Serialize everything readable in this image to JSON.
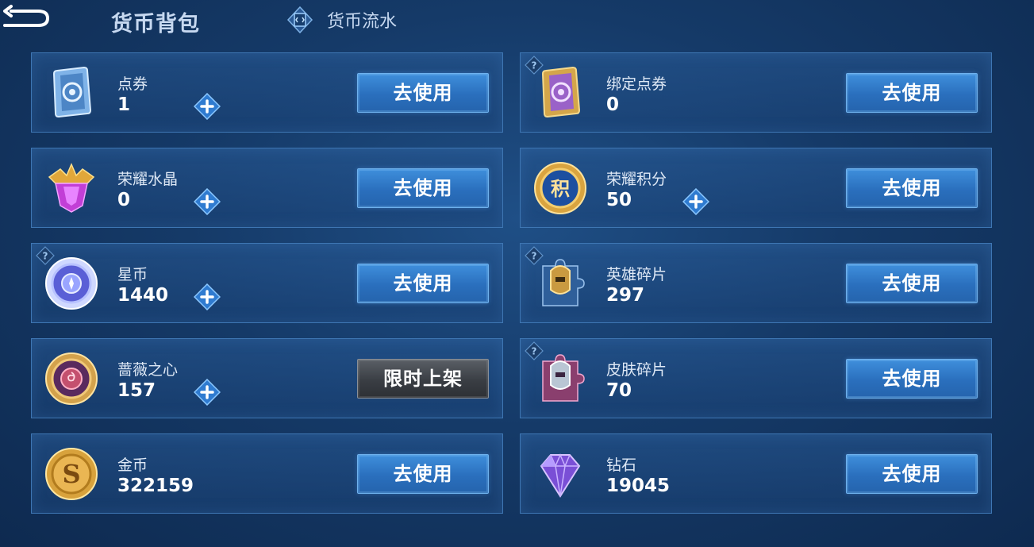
{
  "header": {
    "title": "货币背包",
    "flow_tab_label": "货币流水"
  },
  "cards": [
    {
      "name": "点券",
      "amount": "1",
      "button": "去使用",
      "has_plus": true,
      "has_help": false,
      "icon": "blue-ticket-card-icon"
    },
    {
      "name": "绑定点券",
      "amount": "0",
      "button": "去使用",
      "has_plus": false,
      "has_help": true,
      "icon": "purple-ticket-card-icon"
    },
    {
      "name": "荣耀水晶",
      "amount": "0",
      "button": "去使用",
      "has_plus": true,
      "has_help": false,
      "icon": "glory-crystal-icon"
    },
    {
      "name": "荣耀积分",
      "amount": "50",
      "button": "去使用",
      "has_plus": true,
      "has_help": false,
      "icon": "glory-points-coin-icon"
    },
    {
      "name": "星币",
      "amount": "1440",
      "button": "去使用",
      "has_plus": true,
      "has_help": true,
      "icon": "star-coin-icon"
    },
    {
      "name": "英雄碎片",
      "amount": "297",
      "button": "去使用",
      "has_plus": false,
      "has_help": true,
      "icon": "hero-fragment-icon"
    },
    {
      "name": "蔷薇之心",
      "amount": "157",
      "button": "限时上架",
      "has_plus": true,
      "has_help": false,
      "icon": "rose-heart-coin-icon"
    },
    {
      "name": "皮肤碎片",
      "amount": "70",
      "button": "去使用",
      "has_plus": false,
      "has_help": true,
      "icon": "skin-fragment-icon"
    },
    {
      "name": "金币",
      "amount": "322159",
      "button": "去使用",
      "has_plus": false,
      "has_help": false,
      "icon": "gold-coin-icon"
    },
    {
      "name": "钻石",
      "amount": "19045",
      "button": "去使用",
      "has_plus": false,
      "has_help": false,
      "icon": "diamond-icon"
    }
  ],
  "colors": {
    "button_blue": "#2f7bd0",
    "button_gray": "#3a3e44",
    "card_border": "#3e76b3",
    "plus_diamond": "#2f7bd0"
  }
}
